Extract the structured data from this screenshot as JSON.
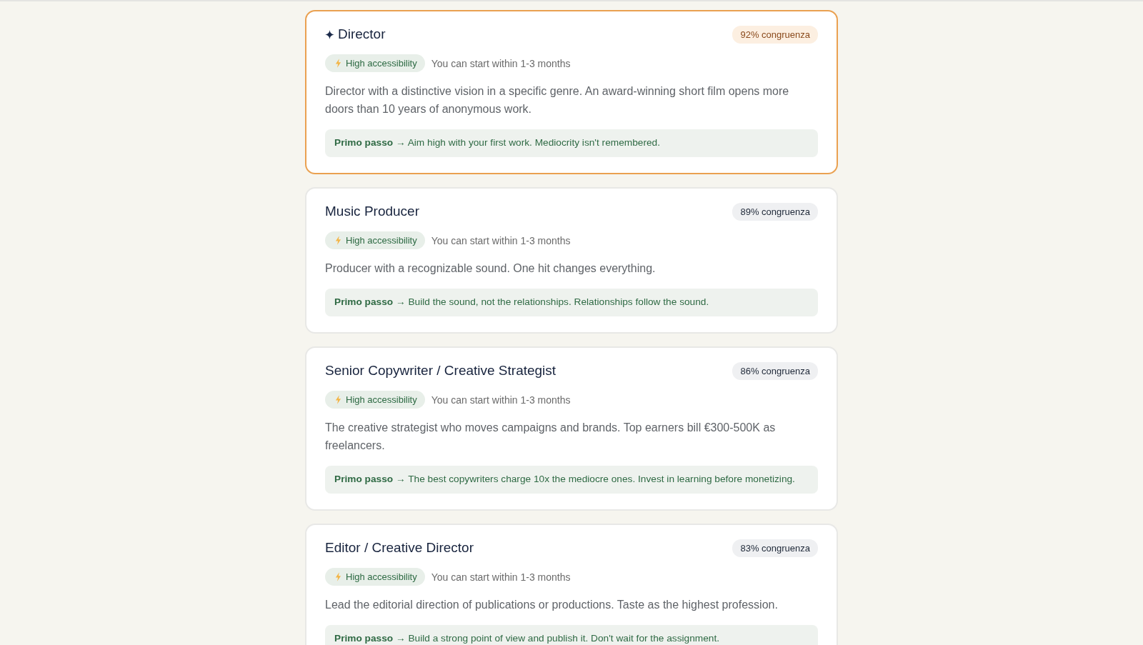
{
  "careers": [
    {
      "title": "Director",
      "highlighted": true,
      "match": "92% congruenza",
      "accessibility": "High accessibility",
      "start": "You can start within 1-3 months",
      "description": "Director with a distinctive vision in a specific genre. An award-winning short film opens more doors than 10 years of anonymous work.",
      "first_step": "**Primo passo →** Aim high with your first work. Mediocrity isn't remembered."
    },
    {
      "title": "Music Producer",
      "highlighted": false,
      "match": "89% congruenza",
      "accessibility": "High accessibility",
      "start": "You can start within 1-3 months",
      "description": "Producer with a recognizable sound. One hit changes everything.",
      "first_step": "**Primo passo →** Build the sound, not the relationships. Relationships follow the sound."
    },
    {
      "title": "Senior Copywriter / Creative Strategist",
      "highlighted": false,
      "match": "86% congruenza",
      "accessibility": "High accessibility",
      "start": "You can start within 1-3 months",
      "description": "The creative strategist who moves campaigns and brands. Top earners bill €300-500K as freelancers.",
      "first_step": "**Primo passo →** The best copywriters charge 10x the mediocre ones. Invest in learning before monetizing."
    },
    {
      "title": "Editor / Creative Director",
      "highlighted": false,
      "match": "83% congruenza",
      "accessibility": "High accessibility",
      "start": "You can start within 1-3 months",
      "description": "Lead the editorial direction of publications or productions. Taste as the highest profession.",
      "first_step": "**Primo passo →** Build a strong point of view and publish it. Don't wait for the assignment."
    }
  ]
}
